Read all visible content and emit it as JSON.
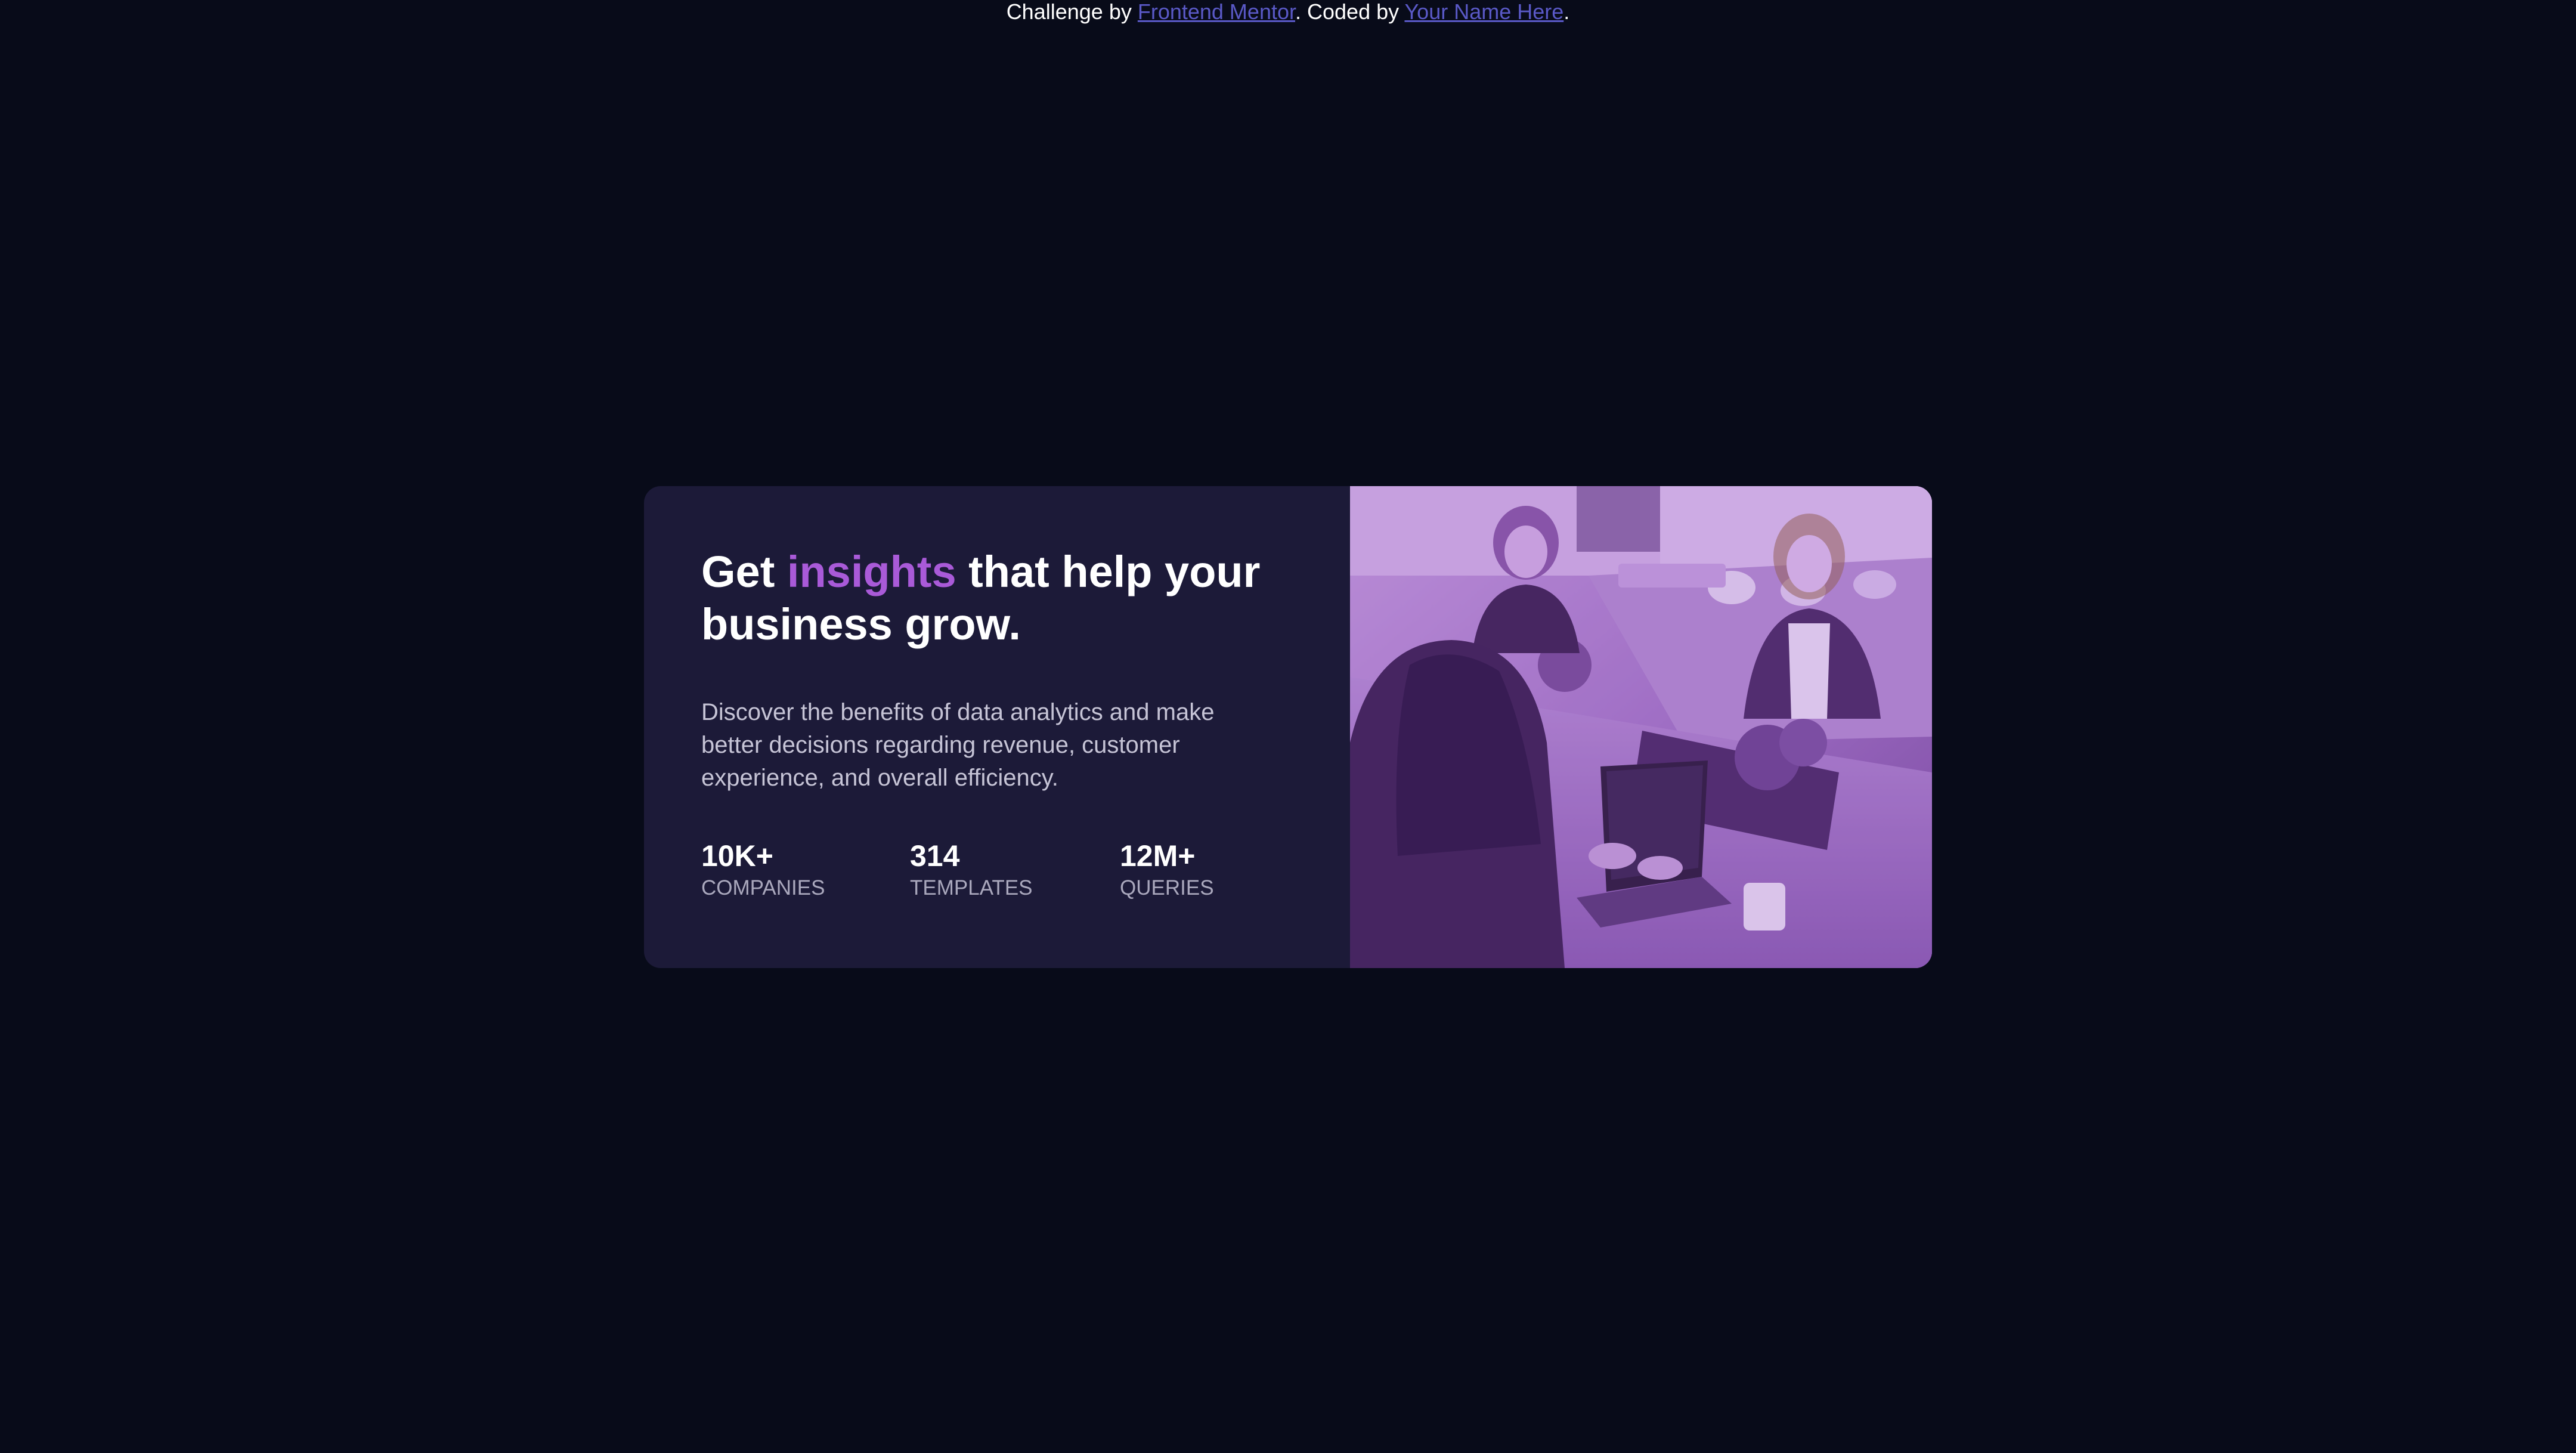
{
  "attribution": {
    "prefix": "Challenge by ",
    "link1": "Frontend Mentor",
    "middle": ". Coded by ",
    "link2": "Your Name Here",
    "suffix": "."
  },
  "card": {
    "headline_before": "Get ",
    "headline_accent": "insights",
    "headline_after": " that help your business grow.",
    "description": "Discover the benefits of data analytics and make better decisions regarding revenue, customer experience, and overall efficiency.",
    "stats": [
      {
        "value": "10K+",
        "label": "companies"
      },
      {
        "value": "314",
        "label": "templates"
      },
      {
        "value": "12M+",
        "label": "queries"
      }
    ]
  },
  "colors": {
    "page_background": "#080b19",
    "card_background": "#1c1a38",
    "accent": "#a95ad8",
    "link": "#5a59c7",
    "image_overlay": "#8a5bb0"
  }
}
